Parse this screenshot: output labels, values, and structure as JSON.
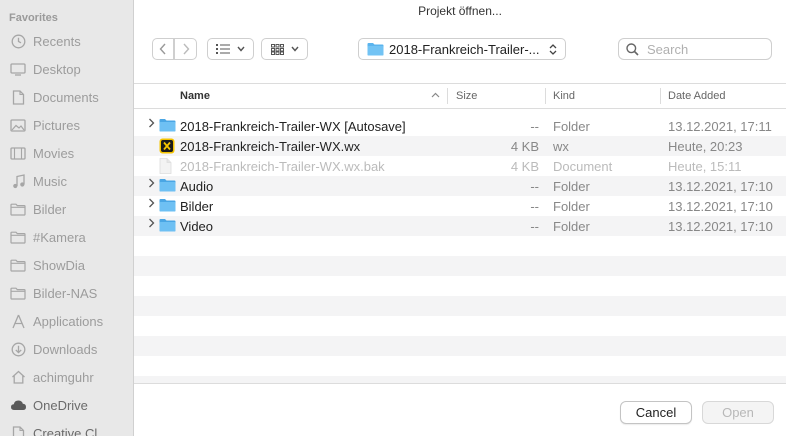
{
  "window": {
    "title": "Projekt öffnen..."
  },
  "sidebar": {
    "section_label": "Favorites",
    "items": [
      {
        "label": "Recents",
        "icon": "clock-icon"
      },
      {
        "label": "Desktop",
        "icon": "desktop-icon"
      },
      {
        "label": "Documents",
        "icon": "document-icon"
      },
      {
        "label": "Pictures",
        "icon": "pictures-icon"
      },
      {
        "label": "Movies",
        "icon": "film-icon"
      },
      {
        "label": "Music",
        "icon": "music-note-icon"
      },
      {
        "label": "Bilder",
        "icon": "folder-icon"
      },
      {
        "label": "#Kamera",
        "icon": "folder-icon"
      },
      {
        "label": "ShowDia",
        "icon": "folder-icon"
      },
      {
        "label": "Bilder-NAS",
        "icon": "folder-icon"
      },
      {
        "label": "Applications",
        "icon": "applications-icon"
      },
      {
        "label": "Downloads",
        "icon": "download-icon"
      },
      {
        "label": "achimguhr",
        "icon": "home-icon"
      },
      {
        "label": "OneDrive",
        "icon": "cloud-icon"
      },
      {
        "label": "Creative Cl",
        "icon": "document-icon"
      }
    ]
  },
  "toolbar": {
    "location": "2018-Frankreich-Trailer-...",
    "search_placeholder": "Search"
  },
  "columns": {
    "name": "Name",
    "size": "Size",
    "kind": "Kind",
    "date_added": "Date Added"
  },
  "files": [
    {
      "name": "2018-Frankreich-Trailer-WX [Autosave]",
      "size": "--",
      "kind": "Folder",
      "date": "13.12.2021, 17:11",
      "type": "folder",
      "expandable": true,
      "enabled": true
    },
    {
      "name": "2018-Frankreich-Trailer-WX.wx",
      "size": "4 KB",
      "kind": "wx",
      "date": "Heute, 20:23",
      "type": "wx",
      "expandable": false,
      "enabled": true
    },
    {
      "name": "2018-Frankreich-Trailer-WX.wx.bak",
      "size": "4 KB",
      "kind": "Document",
      "date": "Heute, 15:11",
      "type": "document",
      "expandable": false,
      "enabled": false
    },
    {
      "name": "Audio",
      "size": "--",
      "kind": "Folder",
      "date": "13.12.2021, 17:10",
      "type": "folder",
      "expandable": true,
      "enabled": true
    },
    {
      "name": "Bilder",
      "size": "--",
      "kind": "Folder",
      "date": "13.12.2021, 17:10",
      "type": "folder",
      "expandable": true,
      "enabled": true
    },
    {
      "name": "Video",
      "size": "--",
      "kind": "Folder",
      "date": "13.12.2021, 17:10",
      "type": "folder",
      "expandable": true,
      "enabled": true
    }
  ],
  "buttons": {
    "cancel": "Cancel",
    "open": "Open"
  },
  "colors": {
    "folder": "#5ab4ee",
    "wx_icon_bg": "#f5c400",
    "sidebar_bg": "#e8e8e8",
    "row_alt": "#f4f4f5"
  }
}
